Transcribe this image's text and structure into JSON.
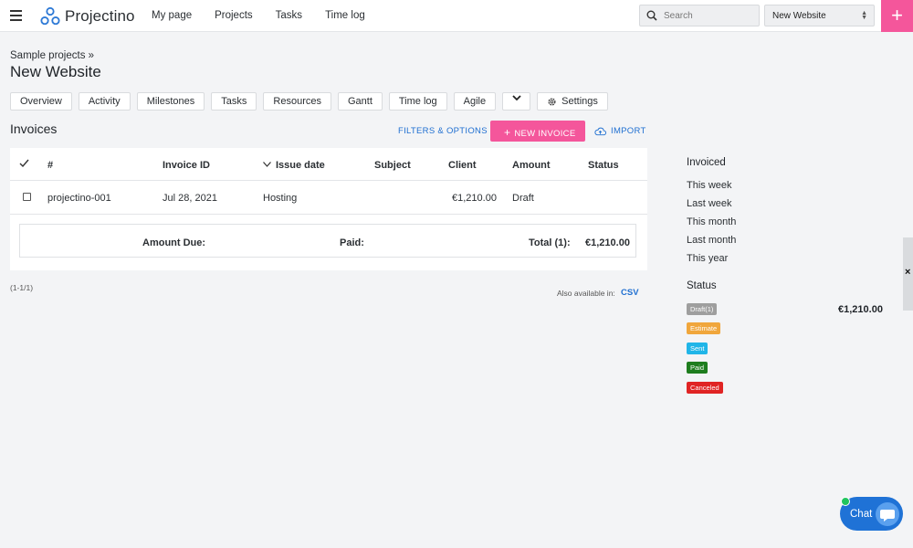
{
  "topbar": {
    "app_name": "Projectino",
    "nav": [
      "My page",
      "Projects",
      "Tasks",
      "Time log"
    ],
    "search_placeholder": "Search",
    "project_select": "New Website",
    "plus_label": "+"
  },
  "header": {
    "breadcrumb": "Sample projects »",
    "title": "New Website"
  },
  "tabs": [
    "Overview",
    "Activity",
    "Milestones",
    "Tasks",
    "Resources",
    "Gantt",
    "Time log",
    "Agile"
  ],
  "settings_tab": "Settings",
  "invoices": {
    "title": "Invoices",
    "filters_label": "FILTERS & OPTIONS",
    "new_label": "NEW INVOICE",
    "import_label": "IMPORT",
    "columns": [
      "#",
      "Invoice ID",
      "Issue date",
      "Subject",
      "Client",
      "Amount",
      "Status"
    ],
    "rows": [
      {
        "id": "projectino-001",
        "date": "Jul 28, 2021",
        "subject": "Hosting",
        "amount": "€1,210.00",
        "status": "Draft"
      }
    ],
    "totals": {
      "amount_due": "Amount Due:",
      "paid": "Paid:",
      "total_label": "Total (1):",
      "total_value": "€1,210.00"
    },
    "pagination": "(1-1/1)",
    "also_available": "Also available in:",
    "csv": "CSV"
  },
  "sidebar": {
    "invoiced_heading": "Invoiced",
    "invoiced_links": [
      "This week",
      "Last week",
      "This month",
      "Last month",
      "This year"
    ],
    "status_heading": "Status",
    "statuses": [
      {
        "label": "Draft(1)",
        "color": "#9e9e9e"
      },
      {
        "label": "Estimate",
        "color": "#f0a63c"
      },
      {
        "label": "Sent",
        "color": "#20b5e8"
      },
      {
        "label": "Paid",
        "color": "#1e7d1e"
      },
      {
        "label": "Canceled",
        "color": "#e02424"
      }
    ],
    "draft_amount": "€1,210.00"
  },
  "edge_close": "×",
  "chat": {
    "label": "Chat"
  },
  "colors": {
    "accent_pink": "#f4569b",
    "link_blue": "#1f6fd1",
    "chat_blue": "#1f72d6"
  }
}
